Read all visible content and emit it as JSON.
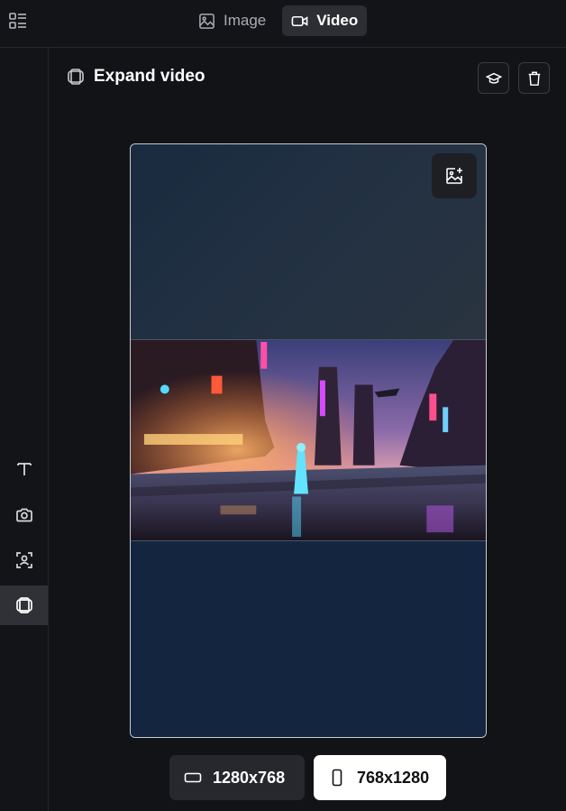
{
  "topbar": {
    "tabs": [
      {
        "label": "Image",
        "icon": "image-icon",
        "active": false
      },
      {
        "label": "Video",
        "icon": "video-camera-icon",
        "active": true
      }
    ]
  },
  "sidebar": {
    "items": [
      {
        "icon": "text-icon",
        "active": false
      },
      {
        "icon": "camera-icon",
        "active": false
      },
      {
        "icon": "person-scan-icon",
        "active": false
      },
      {
        "icon": "expand-frames-icon",
        "active": true
      }
    ]
  },
  "header": {
    "title": "Expand video",
    "icon": "expand-frames-icon"
  },
  "canvas": {
    "add_image_icon": "image-plus-icon"
  },
  "ratio_options": [
    {
      "label": "1280x768",
      "icon": "landscape-rect-icon",
      "selected": false
    },
    {
      "label": "768x1280",
      "icon": "portrait-rect-icon",
      "selected": true
    }
  ],
  "colors": {
    "background": "#121316",
    "active_tab": "#2c2e33",
    "selected_ratio": "#ffffff"
  }
}
